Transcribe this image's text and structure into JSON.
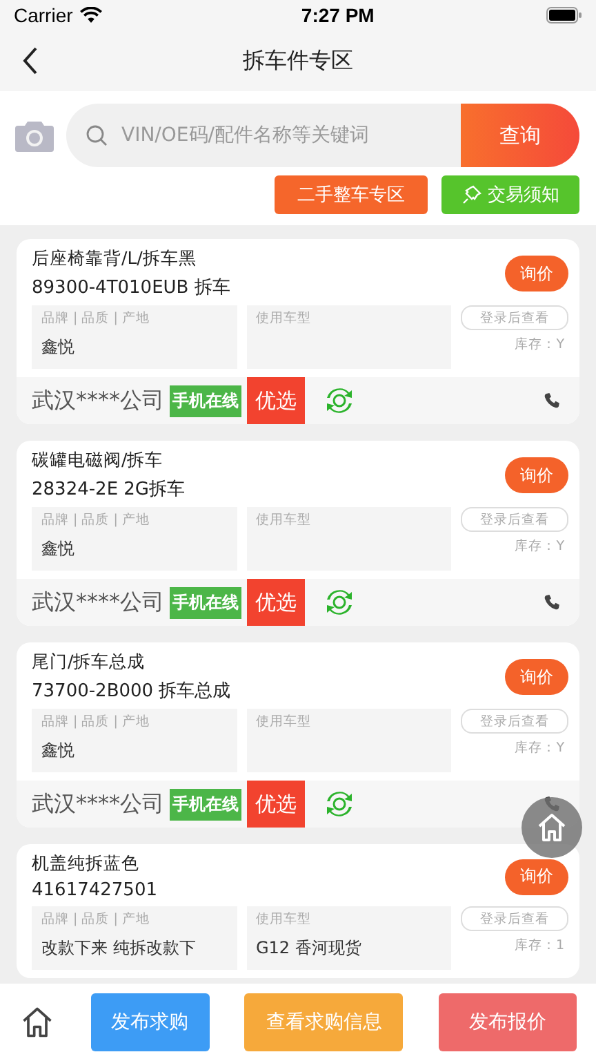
{
  "status_bar": {
    "carrier": "Carrier",
    "time": "7:27 PM"
  },
  "nav": {
    "title": "拆车件专区"
  },
  "search": {
    "placeholder": "VIN/OE码/配件名称等关键词",
    "button": "查询"
  },
  "quick_links": [
    {
      "label": "二手整车专区",
      "kind": "zone"
    },
    {
      "label": "交易须知",
      "kind": "notice"
    }
  ],
  "cards": [
    {
      "title": "后座椅靠背/L/拆车黑",
      "part_no": "89300-4T010EUB 拆车",
      "inquiry": "询价",
      "brand_label": "品牌 | 品质 | 产地",
      "brand": "鑫悦",
      "model_label": "使用车型",
      "login": "登录后查看",
      "stock": "库存：Y",
      "footer": {
        "company": "武汉****公司",
        "online": "手机在线",
        "featured": "优选"
      }
    },
    {
      "title": "碳罐电磁阀/拆车",
      "part_no": "28324-2E 2G拆车",
      "inquiry": "询价",
      "brand_label": "品牌 | 品质 | 产地",
      "brand": "鑫悦",
      "model_label": "使用车型",
      "login": "登录后查看",
      "stock": "库存：Y",
      "footer": {
        "company": "武汉****公司",
        "online": "手机在线",
        "featured": "优选"
      }
    },
    {
      "title": "尾门/拆车总成",
      "part_no": "73700-2B000 拆车总成",
      "inquiry": "询价",
      "brand_label": "品牌 | 品质 | 产地",
      "brand": "鑫悦",
      "model_label": "使用车型",
      "login": "登录后查看",
      "stock": "库存：Y",
      "footer": {
        "company": "武汉****公司",
        "online": "手机在线",
        "featured": "优选"
      }
    },
    {
      "title": "机盖纯拆蓝色",
      "part_no": "41617427501",
      "inquiry": "询价",
      "brand_label": "品牌 | 品质 | 产地",
      "brand": "改款下来 纯拆改款下",
      "model_label": "使用车型",
      "model": "G12 香河现货",
      "login": "登录后查看",
      "stock": "库存：1"
    }
  ],
  "bottom_bar": {
    "buttons": [
      {
        "label": "发布求购",
        "kind": "blue"
      },
      {
        "label": "查看求购信息",
        "kind": "orange"
      },
      {
        "label": "发布报价",
        "kind": "red"
      }
    ]
  }
}
